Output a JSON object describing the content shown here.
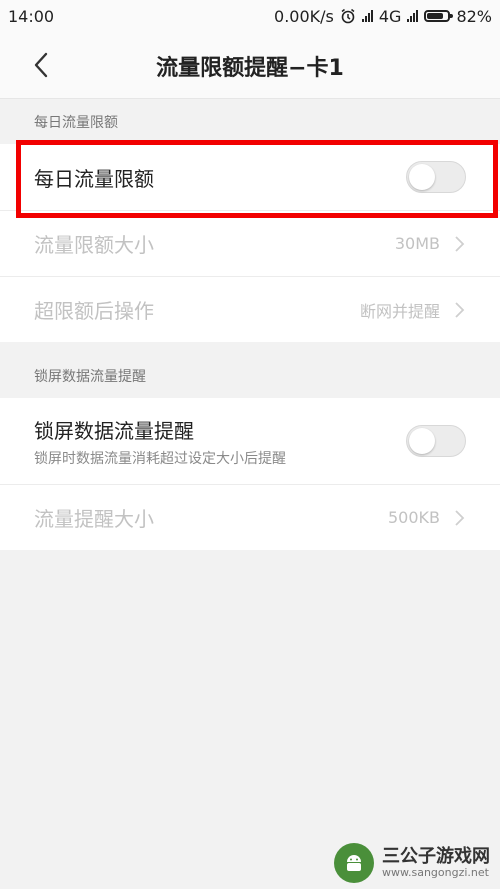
{
  "status_bar": {
    "time": "14:00",
    "speed": "0.00K/s",
    "network": "4G",
    "battery": "82%",
    "battery_level": 0.82
  },
  "header": {
    "title": "流量限额提醒−卡1"
  },
  "section_daily": {
    "label": "每日流量限额",
    "rows": [
      {
        "label": "每日流量限额",
        "toggle": false
      },
      {
        "label": "流量限额大小",
        "value": "30MB"
      },
      {
        "label": "超限额后操作",
        "value": "断网并提醒"
      }
    ]
  },
  "section_lockscreen": {
    "label": "锁屏数据流量提醒",
    "rows": [
      {
        "label": "锁屏数据流量提醒",
        "subtitle": "锁屏时数据流量消耗超过设定大小后提醒",
        "toggle": false
      },
      {
        "label": "流量提醒大小",
        "value": "500KB"
      }
    ]
  },
  "watermark": {
    "name": "三公子游戏网",
    "url": "www.sangongzi.net"
  },
  "colors": {
    "highlight": "#f20000",
    "background": "#f2f2f2"
  }
}
